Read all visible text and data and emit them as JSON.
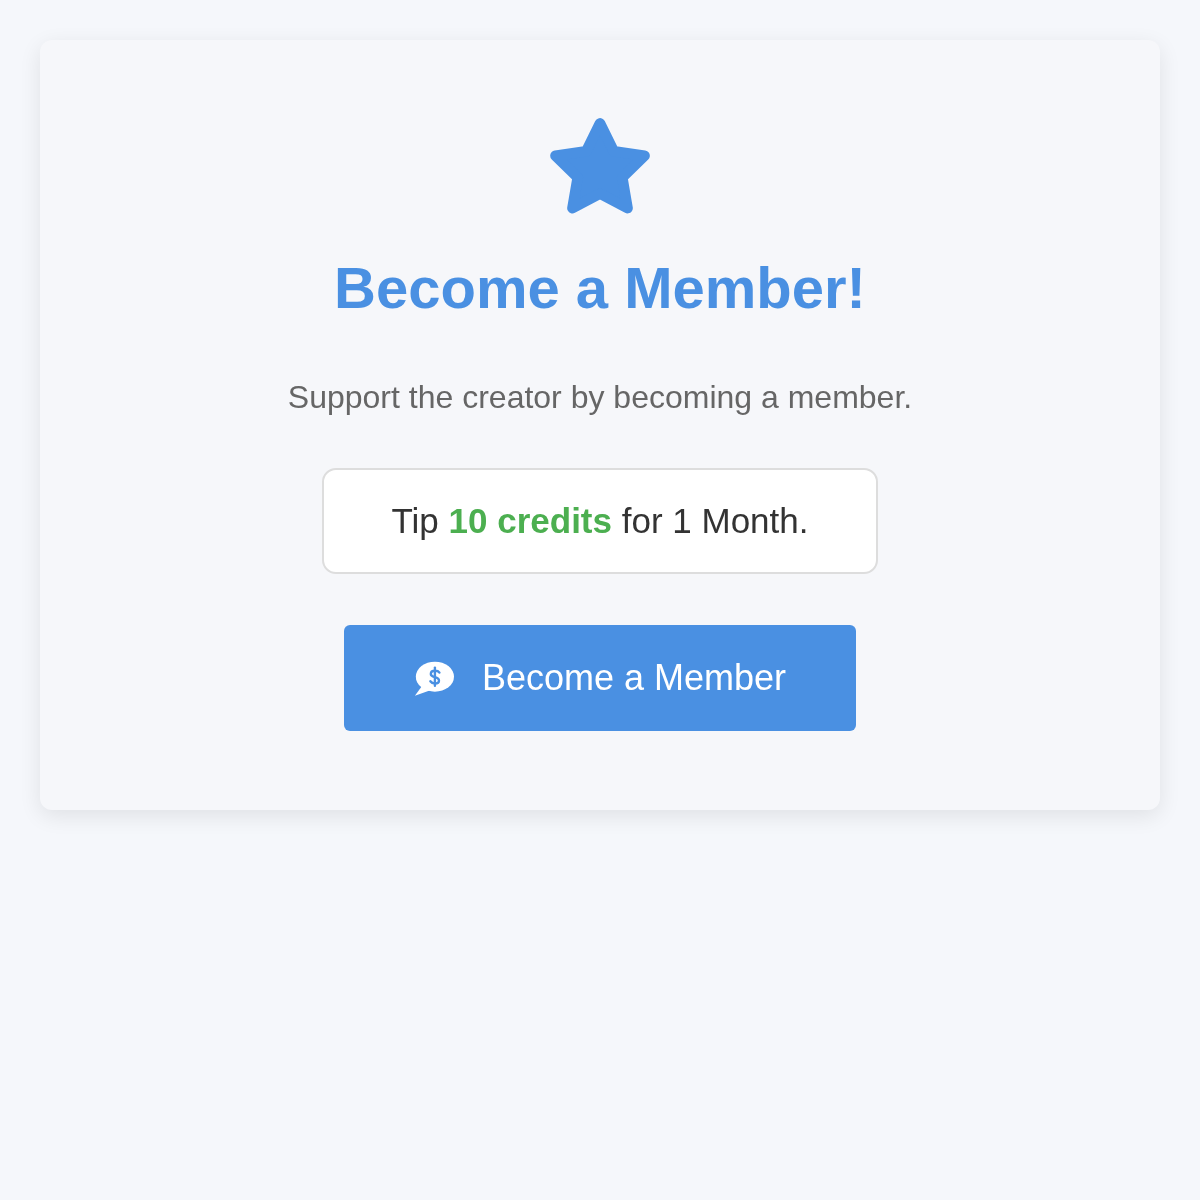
{
  "card": {
    "title": "Become a Member!",
    "subtitle": "Support the creator by becoming a member.",
    "offer": "Tip **10 credits** for 1 Month.",
    "button": {
      "label": "Become a Member"
    }
  }
}
